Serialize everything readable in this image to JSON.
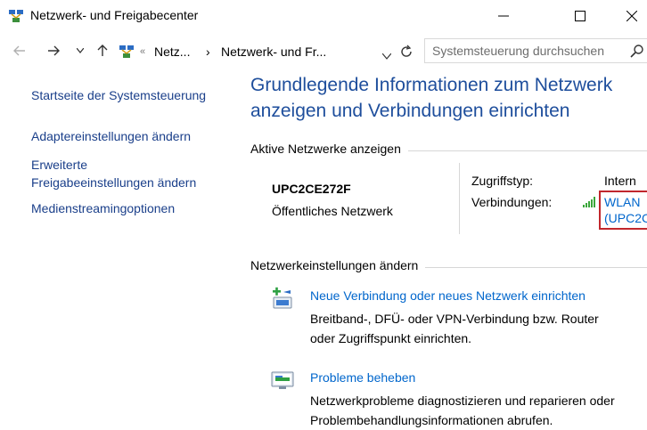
{
  "window": {
    "title": "Netzwerk- und Freigabecenter"
  },
  "address": {
    "crumb_sep": "«",
    "crumb1": "Netz...",
    "crumb_arrow": "›",
    "crumb2": "Netzwerk- und Fr...",
    "search_placeholder": "Systemsteuerung durchsuchen"
  },
  "sidebar": {
    "home": "Startseite der Systemsteuerung",
    "adapter": "Adaptereinstellungen ändern",
    "advanced_line1": "Erweiterte",
    "advanced_line2": "Freigabeeinstellungen ändern",
    "media": "Medienstreamingoptionen"
  },
  "main": {
    "heading_line1": "Grundlegende Informationen zum Netzwerk",
    "heading_line2": "anzeigen und Verbindungen einrichten",
    "active_label": "Aktive Netzwerke anzeigen",
    "network_name": "UPC2CE272F",
    "network_type": "Öffentliches Netzwerk",
    "access_key": "Zugriffstyp:",
    "access_value": "Intern",
    "conn_key": "Verbindungen:",
    "conn_value_line1": "WLAN",
    "conn_value_line2": "(UPC2C",
    "change_label": "Netzwerkeinstellungen ändern",
    "task1_title": "Neue Verbindung oder neues Netzwerk einrichten",
    "task1_desc_line1": "Breitband-, DFÜ- oder VPN-Verbindung bzw. Router",
    "task1_desc_line2": "oder Zugriffspunkt einrichten.",
    "task2_title": "Probleme beheben",
    "task2_desc_line1": "Netzwerkprobleme diagnostizieren und reparieren oder",
    "task2_desc_line2": "Problembehandlungsinformationen abrufen."
  },
  "colors": {
    "heading": "#1e4e9c",
    "sidebar_link": "#1a3f8a",
    "link": "#0066cc",
    "highlight": "#c1272d"
  },
  "icons": [
    "network-center-icon",
    "minimize-icon",
    "maximize-icon",
    "close-icon",
    "back-arrow-icon",
    "forward-arrow-icon",
    "recent-dropdown-icon",
    "up-arrow-icon",
    "refresh-icon",
    "search-icon",
    "wifi-signal-icon",
    "new-connection-icon",
    "troubleshoot-icon"
  ]
}
